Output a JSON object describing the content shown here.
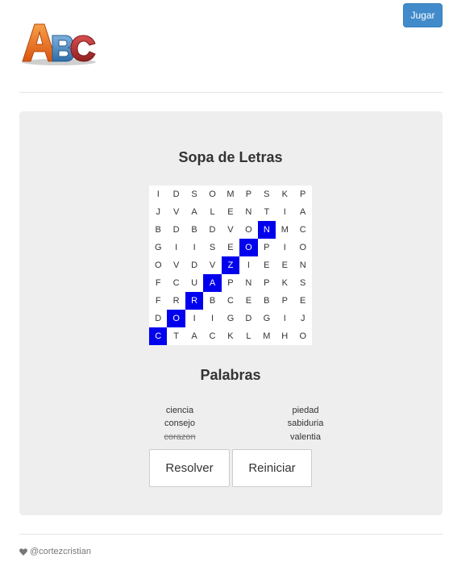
{
  "header": {
    "play_label": "Jugar",
    "logo_text": "ABC",
    "logo_colors": [
      "#e86a1a",
      "#3a7bbd",
      "#b02a2a"
    ]
  },
  "game": {
    "title": "Sopa de Letras",
    "grid": [
      [
        "I",
        "D",
        "S",
        "O",
        "M",
        "P",
        "S",
        "K",
        "P"
      ],
      [
        "J",
        "V",
        "A",
        "L",
        "E",
        "N",
        "T",
        "I",
        "A"
      ],
      [
        "B",
        "D",
        "B",
        "D",
        "V",
        "O",
        "N",
        "M",
        "C"
      ],
      [
        "G",
        "I",
        "I",
        "S",
        "E",
        "O",
        "P",
        "I",
        "O"
      ],
      [
        "O",
        "V",
        "D",
        "V",
        "Z",
        "I",
        "E",
        "E",
        "N"
      ],
      [
        "F",
        "C",
        "U",
        "A",
        "P",
        "N",
        "P",
        "K",
        "S"
      ],
      [
        "F",
        "R",
        "R",
        "B",
        "C",
        "E",
        "B",
        "P",
        "E"
      ],
      [
        "D",
        "O",
        "I",
        "I",
        "G",
        "D",
        "G",
        "I",
        "J"
      ],
      [
        "C",
        "T",
        "A",
        "C",
        "K",
        "L",
        "M",
        "H",
        "O"
      ]
    ],
    "highlighted": [
      [
        2,
        6
      ],
      [
        3,
        5
      ],
      [
        4,
        4
      ],
      [
        5,
        3
      ],
      [
        6,
        2
      ],
      [
        7,
        1
      ],
      [
        8,
        0
      ]
    ],
    "highlight_color": "#0000ee"
  },
  "words": {
    "title": "Palabras",
    "left": [
      {
        "text": "ciencia",
        "found": false
      },
      {
        "text": "consejo",
        "found": false
      },
      {
        "text": "corazon",
        "found": true
      }
    ],
    "right": [
      {
        "text": "piedad",
        "found": false
      },
      {
        "text": "sabiduria",
        "found": false
      },
      {
        "text": "valentia",
        "found": false
      }
    ]
  },
  "actions": {
    "solve_label": "Resolver",
    "reset_label": "Reiniciar"
  },
  "footer": {
    "icon": "heart-icon",
    "credit": "@cortezcristian"
  }
}
